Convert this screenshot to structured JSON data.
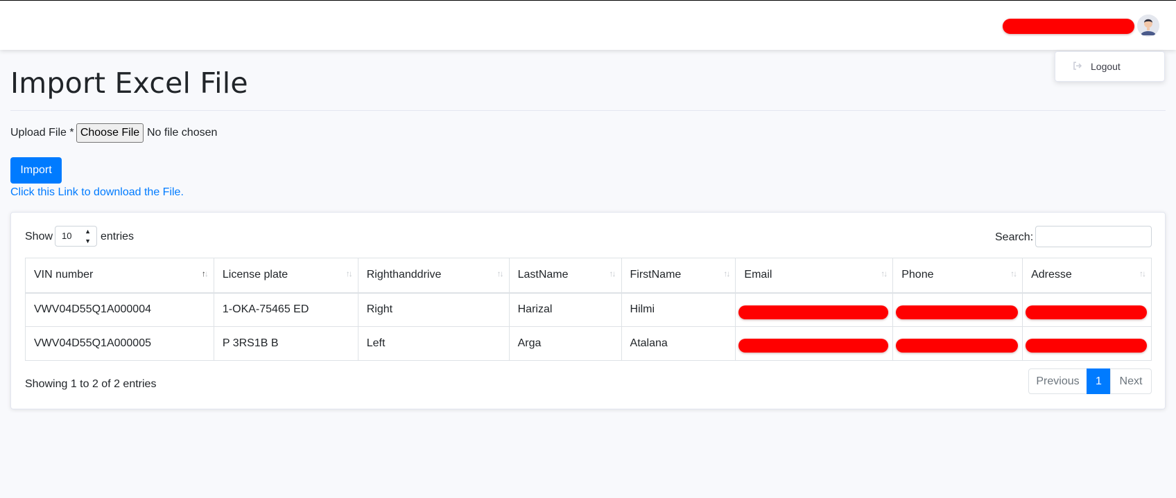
{
  "header": {
    "user_name": "",
    "menu": {
      "logout_label": "Logout"
    }
  },
  "page": {
    "title": "Import Excel File",
    "upload_label": "Upload File *",
    "choose_button": "Choose File",
    "file_status": "No file chosen",
    "import_button": "Import",
    "download_link": "Click this Link to download the File."
  },
  "table": {
    "length": {
      "show": "Show",
      "selected": "10",
      "entries": "entries"
    },
    "search_label": "Search:",
    "search_value": "",
    "columns": [
      "VIN number",
      "License plate",
      "Righthanddrive",
      "LastName",
      "FirstName",
      "Email",
      "Phone",
      "Adresse"
    ],
    "sorted_column": "VIN number",
    "rows": [
      {
        "vin": "VWV04D55Q1A000004",
        "plate": "1-OKA-75465 ED",
        "rhd": "Right",
        "last": "Harizal",
        "first": "Hilmi",
        "email": "",
        "phone": "",
        "address": ""
      },
      {
        "vin": "VWV04D55Q1A000005",
        "plate": "P 3RS1B B",
        "rhd": "Left",
        "last": "Arga",
        "first": "Atalana",
        "email": "",
        "phone": "",
        "address": ""
      }
    ],
    "info": "Showing 1 to 2 of 2 entries",
    "pagination": {
      "previous": "Previous",
      "current": "1",
      "next": "Next"
    }
  },
  "colors": {
    "primary": "#007bff",
    "redaction": "#ff0000",
    "background": "#f8f9fc"
  }
}
